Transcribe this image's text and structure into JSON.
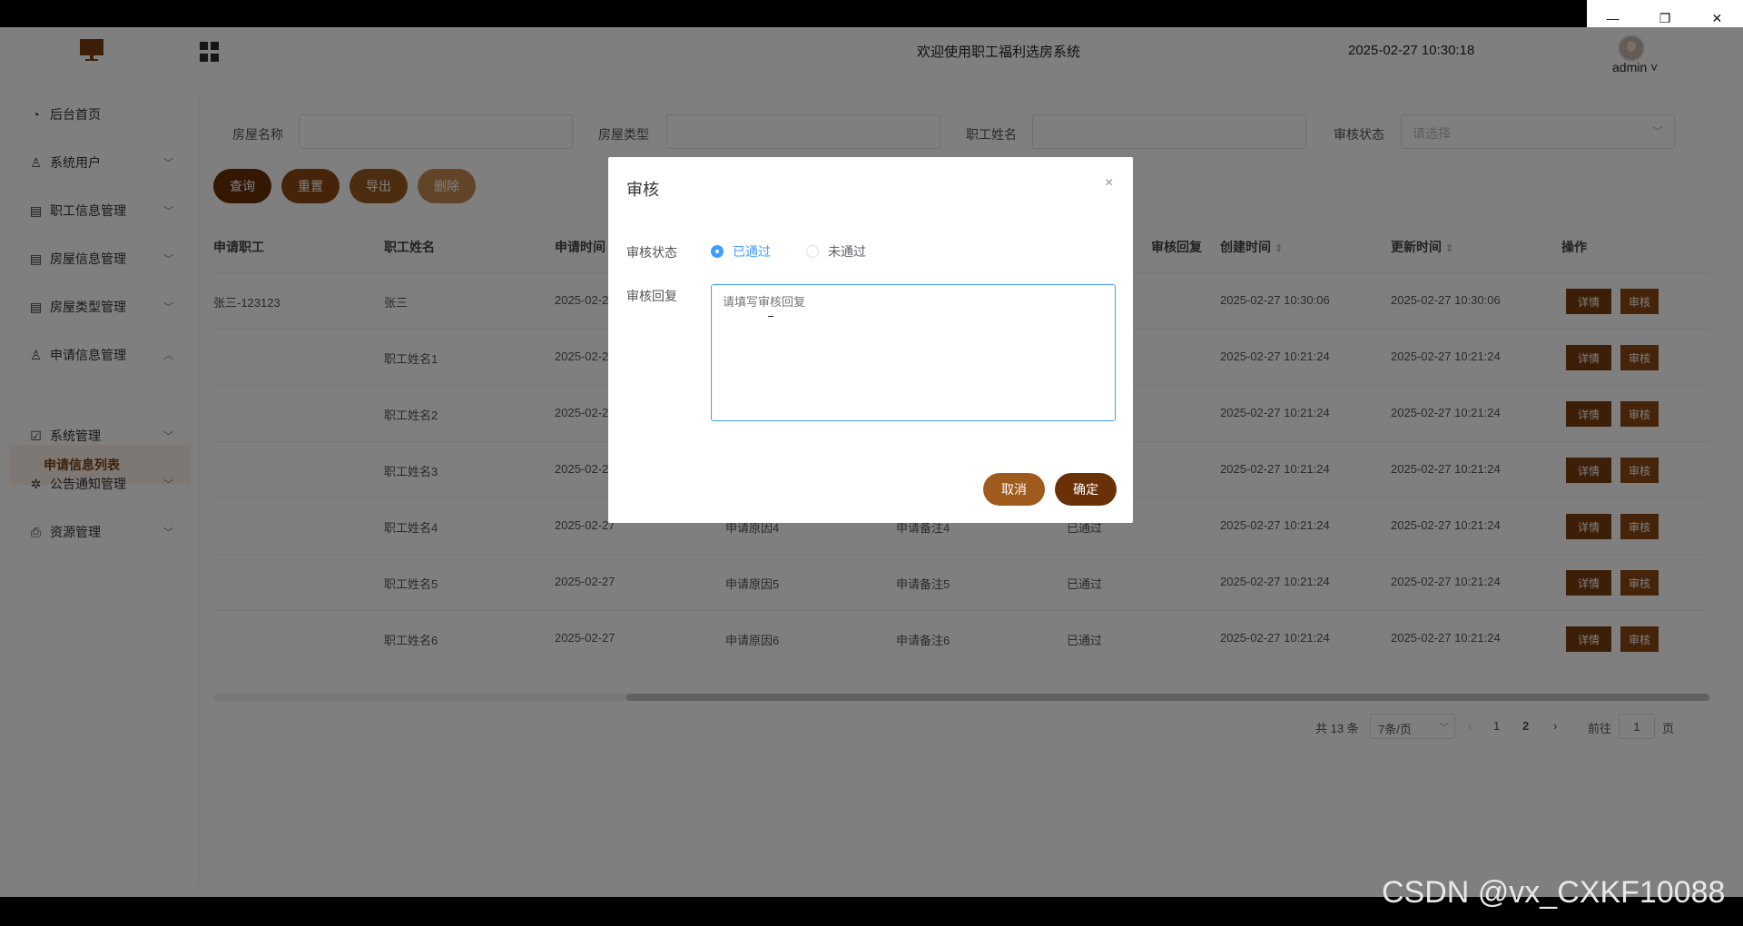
{
  "window": {
    "minimize": "—",
    "restore": "❐",
    "close": "✕"
  },
  "header": {
    "welcome": "欢迎使用职工福利选房系统",
    "datetime": "2025-02-27 10:30:18",
    "user": "admin ˅"
  },
  "sidebar": {
    "items": [
      {
        "label": "后台首页",
        "icon": "clock-icon"
      },
      {
        "label": "系统用户",
        "icon": "user-icon"
      },
      {
        "label": "职工信息管理",
        "icon": "chart-icon"
      },
      {
        "label": "房屋信息管理",
        "icon": "chart-icon"
      },
      {
        "label": "房屋类型管理",
        "icon": "chart-icon"
      },
      {
        "label": "申请信息管理",
        "icon": "user-icon"
      },
      {
        "label": "系统管理",
        "icon": "check-icon"
      },
      {
        "label": "公告通知管理",
        "icon": "gear-icon"
      },
      {
        "label": "资源管理",
        "icon": "printer-icon"
      }
    ],
    "active_sub": "申请信息列表"
  },
  "filters": {
    "house_name": "房屋名称",
    "house_type": "房屋类型",
    "employee_name": "职工姓名",
    "review_status": "审核状态",
    "review_placeholder": "请选择"
  },
  "buttons": {
    "search": "查询",
    "reset": "重置",
    "export": "导出",
    "delete": "删除"
  },
  "table": {
    "headers": [
      "申请职工",
      "职工姓名",
      "申请时间",
      "审核回复",
      "创建时间",
      "更新时间",
      "操作"
    ],
    "rows": [
      {
        "emp": "张三-123123",
        "name": "张三",
        "time": "2025-02-2",
        "reason": "",
        "remark": "",
        "status": "",
        "created": "2025-02-27 10:30:06",
        "updated": "2025-02-27 10:30:06"
      },
      {
        "emp": "",
        "name": "职工姓名1",
        "time": "2025-02-2",
        "reason": "",
        "remark": "",
        "status": "",
        "created": "2025-02-27 10:21:24",
        "updated": "2025-02-27 10:21:24"
      },
      {
        "emp": "",
        "name": "职工姓名2",
        "time": "2025-02-2",
        "reason": "",
        "remark": "",
        "status": "",
        "created": "2025-02-27 10:21:24",
        "updated": "2025-02-27 10:21:24"
      },
      {
        "emp": "",
        "name": "职工姓名3",
        "time": "2025-02-2",
        "reason": "",
        "remark": "",
        "status": "",
        "created": "2025-02-27 10:21:24",
        "updated": "2025-02-27 10:21:24"
      },
      {
        "emp": "",
        "name": "职工姓名4",
        "time": "2025-02-27",
        "reason": "申请原因4",
        "remark": "申请备注4",
        "status": "已通过",
        "created": "2025-02-27 10:21:24",
        "updated": "2025-02-27 10:21:24"
      },
      {
        "emp": "",
        "name": "职工姓名5",
        "time": "2025-02-27",
        "reason": "申请原因5",
        "remark": "申请备注5",
        "status": "已通过",
        "created": "2025-02-27 10:21:24",
        "updated": "2025-02-27 10:21:24"
      },
      {
        "emp": "",
        "name": "职工姓名6",
        "time": "2025-02-27",
        "reason": "申请原因6",
        "remark": "申请备注6",
        "status": "已通过",
        "created": "2025-02-27 10:21:24",
        "updated": "2025-02-27 10:21:24"
      }
    ],
    "detail_label": "详情",
    "review_label": "审核"
  },
  "pager": {
    "total": "共 13 条",
    "page_size": "7条/页",
    "page1": "1",
    "page2": "2",
    "goto": "前往",
    "goto_value": "1",
    "page_suffix": "页"
  },
  "dialog": {
    "title": "审核",
    "close": "×",
    "status_label": "审核状态",
    "opt_pass": "已通过",
    "opt_fail": "未通过",
    "reply_label": "审核回复",
    "reply_placeholder": "请填写审核回复",
    "cancel": "取消",
    "confirm": "确定"
  },
  "watermark": "CSDN @vx_CXKF10088",
  "colors": {
    "brand": "#7a3e0e",
    "accent": "#a05a1c",
    "link": "#409eff"
  }
}
